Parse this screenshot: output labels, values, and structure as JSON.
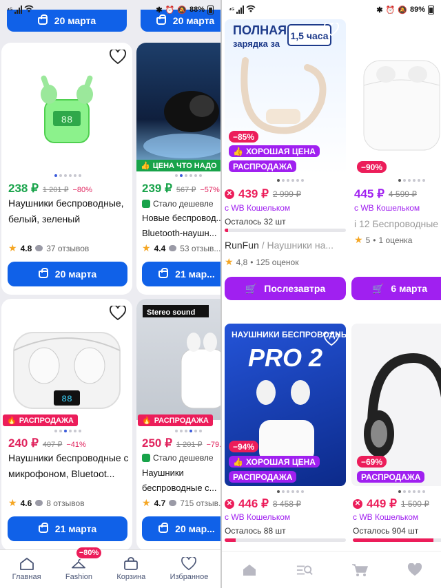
{
  "left_status": {
    "left": "⁴ᴳ",
    "battery": "88%"
  },
  "right_status": {
    "left": "⁴ᴳ",
    "battery": "89%"
  },
  "left_feed": {
    "top_buttons": [
      "20 марта",
      "20 марта"
    ],
    "cards": [
      {
        "price": "238 ₽",
        "old": "1 201 ₽",
        "disc": "−80%",
        "title": "Наушники беспроводные, белый, зеленый",
        "rating": "4.8",
        "reviews": "37 отзывов",
        "delivery": "20 марта",
        "dots": 6,
        "active_dot": 0
      },
      {
        "badge": "ЦЕНА ЧТО НАДО",
        "price": "239 ₽",
        "old": "567 ₽",
        "disc": "−57%",
        "cheaper": "Стало дешевле",
        "title": "Новые беспровод... Bluetooth-наушн...",
        "rating": "4.4",
        "reviews": "53 отзыв...",
        "delivery": "21 мар...",
        "dots": 6,
        "active_dot": 1
      },
      {
        "badge": "РАСПРОДАЖА",
        "price": "240 ₽",
        "old": "407 ₽",
        "disc": "−41%",
        "title": "Наушники беспроводные с микрофоном, Bluetoot...",
        "rating": "4.6",
        "reviews": "8 отзывов",
        "delivery": "21 марта",
        "dots": 6,
        "active_dot": 2
      },
      {
        "badge": "РАСПРОДАЖА",
        "price": "250 ₽",
        "old": "1 201 ₽",
        "disc": "−79...",
        "cheaper": "Стало дешевле",
        "title": "Наушники беспроводные с...",
        "rating": "4.7",
        "reviews": "715 отзыв...",
        "delivery": "20 мар...",
        "dots": 6,
        "active_dot": 3
      }
    ]
  },
  "left_nav": {
    "items": [
      "Главная",
      "Fashion",
      "Корзина",
      "Избранное"
    ],
    "fashion_badge": "−80%"
  },
  "right_feed": {
    "cards": [
      {
        "image_text": [
          "ПОЛНАЯ",
          "зарядка за",
          "1,5 часа"
        ],
        "disc": "−85%",
        "tags": [
          "ХОРОШАЯ ЦЕНА",
          "РАСПРОДАЖА"
        ],
        "price": "439 ₽",
        "old": "2 999 ₽",
        "wallet": "с WB Кошельком",
        "stock": "Осталось 32 шт",
        "stock_fraction": 0.03,
        "brand": "RunFun",
        "name": " / Наушники на...",
        "rating": "4,8",
        "reviews": "125 оценок",
        "button": "Послезавтра",
        "dots": 6,
        "active_dot": 0
      },
      {
        "disc": "−90%",
        "price": "445 ₽",
        "old": "4 599 ₽",
        "wallet": "с WB Кошельком",
        "name": "i 12 Беспроводные",
        "rating": "5",
        "reviews": "1 оценка",
        "button": "6 марта",
        "dots": 6,
        "active_dot": 0
      },
      {
        "image_text": [
          "НАУШНИКИ БЕСПРОВОДНЫЕ",
          "PRO 2"
        ],
        "disc": "−94%",
        "tags": [
          "ХОРОШАЯ ЦЕНА",
          "РАСПРОДАЖА"
        ],
        "price": "446 ₽",
        "old": "8 458 ₽",
        "wallet": "с WB Кошельком",
        "stock": "Осталось 88 шт",
        "stock_fraction": 0.09,
        "dots": 6,
        "active_dot": 0
      },
      {
        "disc": "−69%",
        "tags": [
          "РАСПРОДАЖА"
        ],
        "price": "449 ₽",
        "old": "1 500 ₽",
        "wallet": "с WB Кошельком",
        "stock": "Осталось 904 шт",
        "stock_fraction": 0.9,
        "dots": 6,
        "active_dot": 0
      }
    ]
  },
  "colors": {
    "wb_purple": "#a020f0",
    "ozon_blue": "#1061e8",
    "sale_pink": "#ec1d5a",
    "green": "#18a34a"
  }
}
